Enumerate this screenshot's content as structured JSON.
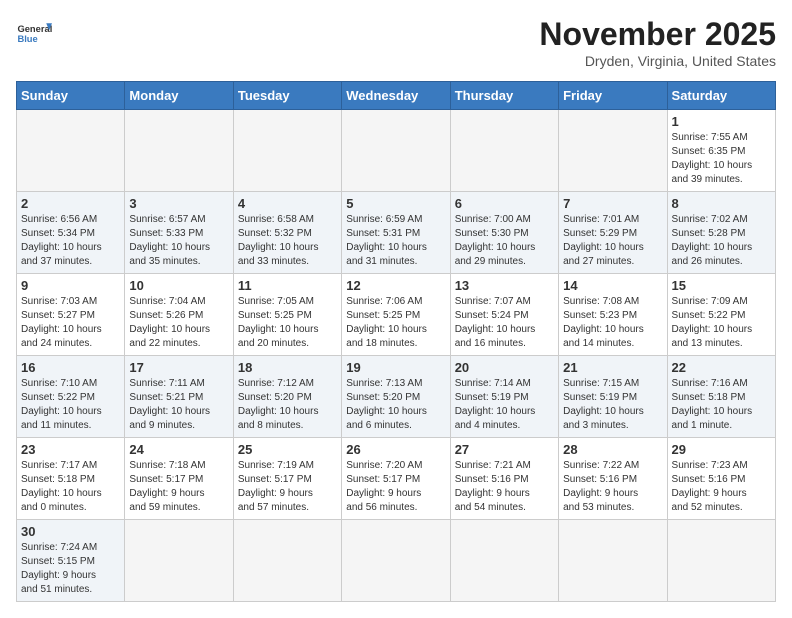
{
  "header": {
    "logo_general": "General",
    "logo_blue": "Blue",
    "month_title": "November 2025",
    "location": "Dryden, Virginia, United States"
  },
  "days_of_week": [
    "Sunday",
    "Monday",
    "Tuesday",
    "Wednesday",
    "Thursday",
    "Friday",
    "Saturday"
  ],
  "weeks": [
    [
      {
        "day": "",
        "info": ""
      },
      {
        "day": "",
        "info": ""
      },
      {
        "day": "",
        "info": ""
      },
      {
        "day": "",
        "info": ""
      },
      {
        "day": "",
        "info": ""
      },
      {
        "day": "",
        "info": ""
      },
      {
        "day": "1",
        "info": "Sunrise: 7:55 AM\nSunset: 6:35 PM\nDaylight: 10 hours\nand 39 minutes."
      }
    ],
    [
      {
        "day": "2",
        "info": "Sunrise: 6:56 AM\nSunset: 5:34 PM\nDaylight: 10 hours\nand 37 minutes."
      },
      {
        "day": "3",
        "info": "Sunrise: 6:57 AM\nSunset: 5:33 PM\nDaylight: 10 hours\nand 35 minutes."
      },
      {
        "day": "4",
        "info": "Sunrise: 6:58 AM\nSunset: 5:32 PM\nDaylight: 10 hours\nand 33 minutes."
      },
      {
        "day": "5",
        "info": "Sunrise: 6:59 AM\nSunset: 5:31 PM\nDaylight: 10 hours\nand 31 minutes."
      },
      {
        "day": "6",
        "info": "Sunrise: 7:00 AM\nSunset: 5:30 PM\nDaylight: 10 hours\nand 29 minutes."
      },
      {
        "day": "7",
        "info": "Sunrise: 7:01 AM\nSunset: 5:29 PM\nDaylight: 10 hours\nand 27 minutes."
      },
      {
        "day": "8",
        "info": "Sunrise: 7:02 AM\nSunset: 5:28 PM\nDaylight: 10 hours\nand 26 minutes."
      }
    ],
    [
      {
        "day": "9",
        "info": "Sunrise: 7:03 AM\nSunset: 5:27 PM\nDaylight: 10 hours\nand 24 minutes."
      },
      {
        "day": "10",
        "info": "Sunrise: 7:04 AM\nSunset: 5:26 PM\nDaylight: 10 hours\nand 22 minutes."
      },
      {
        "day": "11",
        "info": "Sunrise: 7:05 AM\nSunset: 5:25 PM\nDaylight: 10 hours\nand 20 minutes."
      },
      {
        "day": "12",
        "info": "Sunrise: 7:06 AM\nSunset: 5:25 PM\nDaylight: 10 hours\nand 18 minutes."
      },
      {
        "day": "13",
        "info": "Sunrise: 7:07 AM\nSunset: 5:24 PM\nDaylight: 10 hours\nand 16 minutes."
      },
      {
        "day": "14",
        "info": "Sunrise: 7:08 AM\nSunset: 5:23 PM\nDaylight: 10 hours\nand 14 minutes."
      },
      {
        "day": "15",
        "info": "Sunrise: 7:09 AM\nSunset: 5:22 PM\nDaylight: 10 hours\nand 13 minutes."
      }
    ],
    [
      {
        "day": "16",
        "info": "Sunrise: 7:10 AM\nSunset: 5:22 PM\nDaylight: 10 hours\nand 11 minutes."
      },
      {
        "day": "17",
        "info": "Sunrise: 7:11 AM\nSunset: 5:21 PM\nDaylight: 10 hours\nand 9 minutes."
      },
      {
        "day": "18",
        "info": "Sunrise: 7:12 AM\nSunset: 5:20 PM\nDaylight: 10 hours\nand 8 minutes."
      },
      {
        "day": "19",
        "info": "Sunrise: 7:13 AM\nSunset: 5:20 PM\nDaylight: 10 hours\nand 6 minutes."
      },
      {
        "day": "20",
        "info": "Sunrise: 7:14 AM\nSunset: 5:19 PM\nDaylight: 10 hours\nand 4 minutes."
      },
      {
        "day": "21",
        "info": "Sunrise: 7:15 AM\nSunset: 5:19 PM\nDaylight: 10 hours\nand 3 minutes."
      },
      {
        "day": "22",
        "info": "Sunrise: 7:16 AM\nSunset: 5:18 PM\nDaylight: 10 hours\nand 1 minute."
      }
    ],
    [
      {
        "day": "23",
        "info": "Sunrise: 7:17 AM\nSunset: 5:18 PM\nDaylight: 10 hours\nand 0 minutes."
      },
      {
        "day": "24",
        "info": "Sunrise: 7:18 AM\nSunset: 5:17 PM\nDaylight: 9 hours\nand 59 minutes."
      },
      {
        "day": "25",
        "info": "Sunrise: 7:19 AM\nSunset: 5:17 PM\nDaylight: 9 hours\nand 57 minutes."
      },
      {
        "day": "26",
        "info": "Sunrise: 7:20 AM\nSunset: 5:17 PM\nDaylight: 9 hours\nand 56 minutes."
      },
      {
        "day": "27",
        "info": "Sunrise: 7:21 AM\nSunset: 5:16 PM\nDaylight: 9 hours\nand 54 minutes."
      },
      {
        "day": "28",
        "info": "Sunrise: 7:22 AM\nSunset: 5:16 PM\nDaylight: 9 hours\nand 53 minutes."
      },
      {
        "day": "29",
        "info": "Sunrise: 7:23 AM\nSunset: 5:16 PM\nDaylight: 9 hours\nand 52 minutes."
      }
    ],
    [
      {
        "day": "30",
        "info": "Sunrise: 7:24 AM\nSunset: 5:15 PM\nDaylight: 9 hours\nand 51 minutes."
      },
      {
        "day": "",
        "info": ""
      },
      {
        "day": "",
        "info": ""
      },
      {
        "day": "",
        "info": ""
      },
      {
        "day": "",
        "info": ""
      },
      {
        "day": "",
        "info": ""
      },
      {
        "day": "",
        "info": ""
      }
    ]
  ]
}
